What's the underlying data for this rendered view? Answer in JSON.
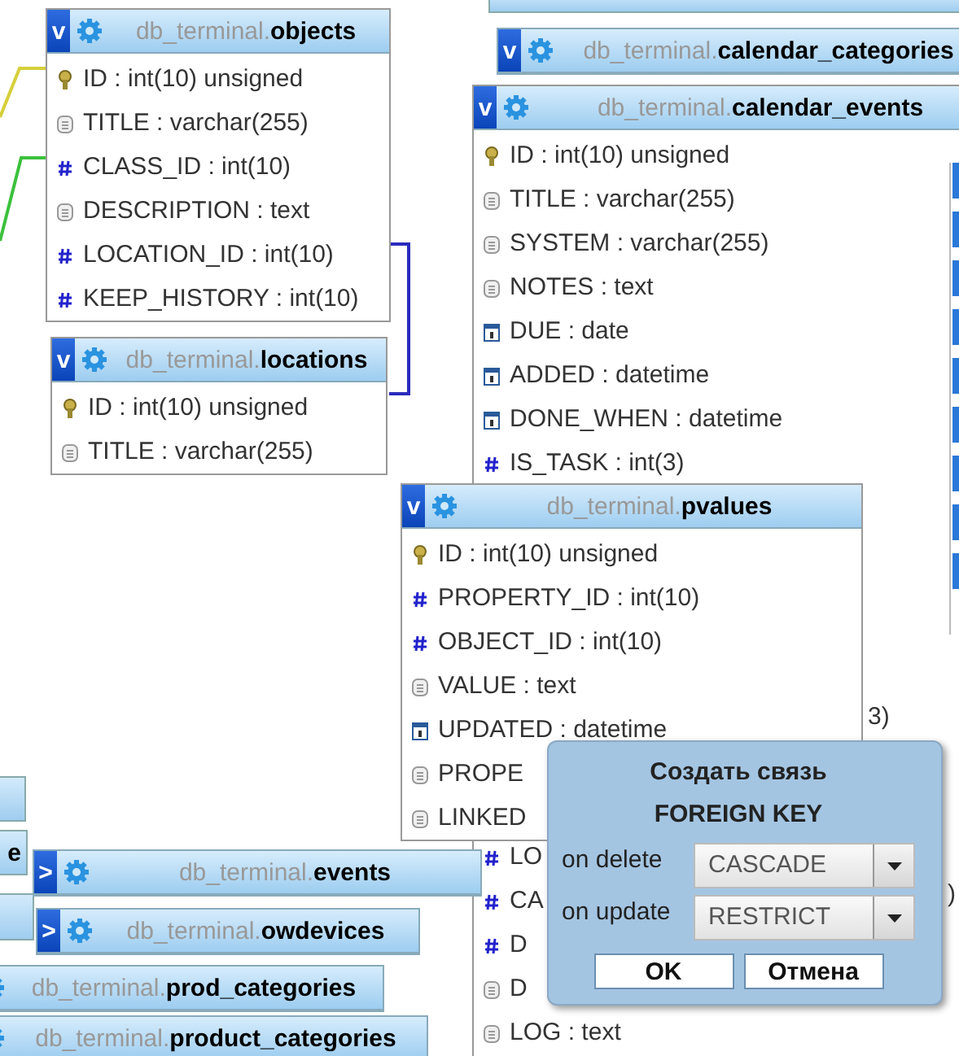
{
  "relations": [
    {
      "color": "#d6cf3a"
    },
    {
      "color": "#3cc13c"
    },
    {
      "color": "#2b2bbd"
    }
  ],
  "left_stub_label": "e",
  "tables": [
    {
      "prefix": "db_terminal.",
      "name": "objects",
      "toggle": "v",
      "columns": [
        {
          "kind": "key",
          "text": "ID : int(10) unsigned"
        },
        {
          "kind": "text",
          "text": "TITLE : varchar(255)"
        },
        {
          "kind": "number",
          "text": "CLASS_ID : int(10)"
        },
        {
          "kind": "text",
          "text": "DESCRIPTION : text"
        },
        {
          "kind": "number",
          "text": "LOCATION_ID : int(10)"
        },
        {
          "kind": "number",
          "text": "KEEP_HISTORY : int(10)"
        }
      ]
    },
    {
      "prefix": "db_terminal.",
      "name": "locations",
      "toggle": "v",
      "columns": [
        {
          "kind": "key",
          "text": "ID : int(10) unsigned"
        },
        {
          "kind": "text",
          "text": "TITLE : varchar(255)"
        }
      ]
    },
    {
      "prefix": "db_terminal.",
      "name": "calendar_categories",
      "toggle": "v"
    },
    {
      "prefix": "db_terminal.",
      "name": "calendar_events",
      "toggle": "v",
      "columns": [
        {
          "kind": "key",
          "text": "ID : int(10) unsigned"
        },
        {
          "kind": "text",
          "text": "TITLE : varchar(255)"
        },
        {
          "kind": "text",
          "text": "SYSTEM : varchar(255)"
        },
        {
          "kind": "text",
          "text": "NOTES : text"
        },
        {
          "kind": "date",
          "text": "DUE : date"
        },
        {
          "kind": "date",
          "text": "ADDED : datetime"
        },
        {
          "kind": "date",
          "text": "DONE_WHEN : datetime"
        },
        {
          "kind": "number",
          "text": "IS_TASK : int(3)"
        }
      ],
      "lower_columns": [
        {
          "kind": "number",
          "text": "LO"
        },
        {
          "kind": "number",
          "text": "CA"
        },
        {
          "kind": "number",
          "text": "D"
        },
        {
          "kind": "text",
          "text": "D"
        },
        {
          "kind": "text",
          "text": "LOG : text"
        }
      ],
      "tails": [
        "3)",
        ")"
      ]
    },
    {
      "prefix": "db_terminal.",
      "name": "pvalues",
      "toggle": "v",
      "columns": [
        {
          "kind": "key",
          "text": "ID : int(10) unsigned"
        },
        {
          "kind": "number",
          "text": "PROPERTY_ID : int(10)"
        },
        {
          "kind": "number",
          "text": "OBJECT_ID : int(10)"
        },
        {
          "kind": "text",
          "text": "VALUE : text"
        },
        {
          "kind": "date",
          "text": "UPDATED : datetime"
        },
        {
          "kind": "text",
          "text": "PROPE"
        },
        {
          "kind": "text",
          "text": "LINKED"
        }
      ]
    },
    {
      "prefix": "db_terminal.",
      "name": "events",
      "toggle": ">"
    },
    {
      "prefix": "db_terminal.",
      "name": "owdevices",
      "toggle": ">"
    },
    {
      "prefix": "db_terminal.",
      "name": "prod_categories"
    },
    {
      "prefix": "db_terminal.",
      "name": "product_categories"
    }
  ],
  "dialog": {
    "title": "Создать связь",
    "subtitle": "FOREIGN KEY",
    "fields": [
      {
        "label": "on delete",
        "value": "CASCADE"
      },
      {
        "label": "on update",
        "value": "RESTRICT"
      }
    ],
    "buttons": [
      "OK",
      "Отмена"
    ]
  }
}
